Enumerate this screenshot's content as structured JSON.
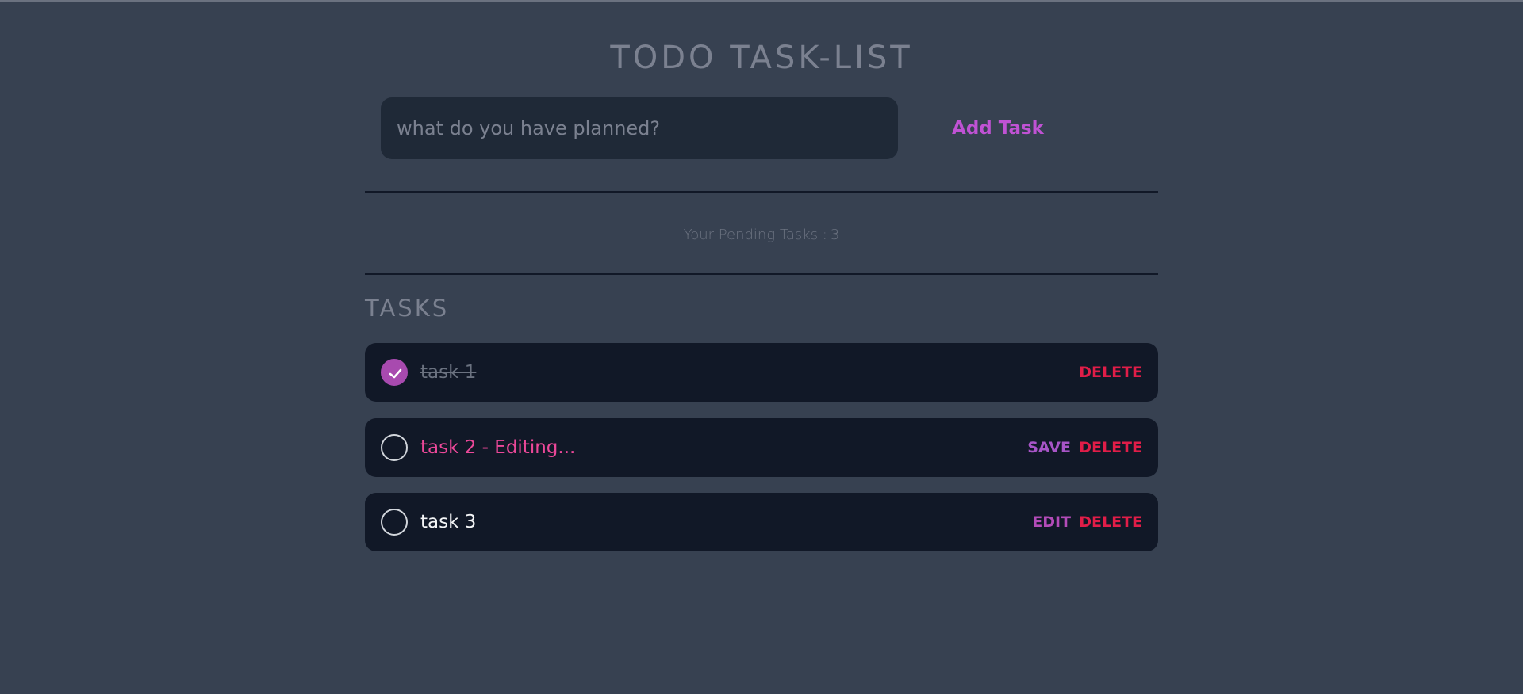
{
  "header": {
    "title": "TODO TASK-LIST"
  },
  "input": {
    "placeholder": "what do you have planned?",
    "value": ""
  },
  "add_button": {
    "label": "Add Task"
  },
  "pending": {
    "label": "Your Pending Tasks :",
    "count": "3"
  },
  "section": {
    "title": "TASKS"
  },
  "tasks": [
    {
      "text": "task 1",
      "completed": true,
      "state": "done",
      "delete_label": "DELETE"
    },
    {
      "text": "task 2 - Editing...",
      "completed": false,
      "state": "editing",
      "save_label": "SAVE",
      "delete_label": "DELETE"
    },
    {
      "text": "task 3",
      "completed": false,
      "state": "normal",
      "edit_label": "EDIT",
      "delete_label": "DELETE"
    }
  ],
  "colors": {
    "background": "#374151",
    "card": "#111827",
    "input": "#1f2937",
    "accent": "#c052d4",
    "checked": "#a84aaf",
    "editing_text": "#ec4899",
    "delete": "#e11d48"
  },
  "icons": {
    "check": "check-icon"
  }
}
